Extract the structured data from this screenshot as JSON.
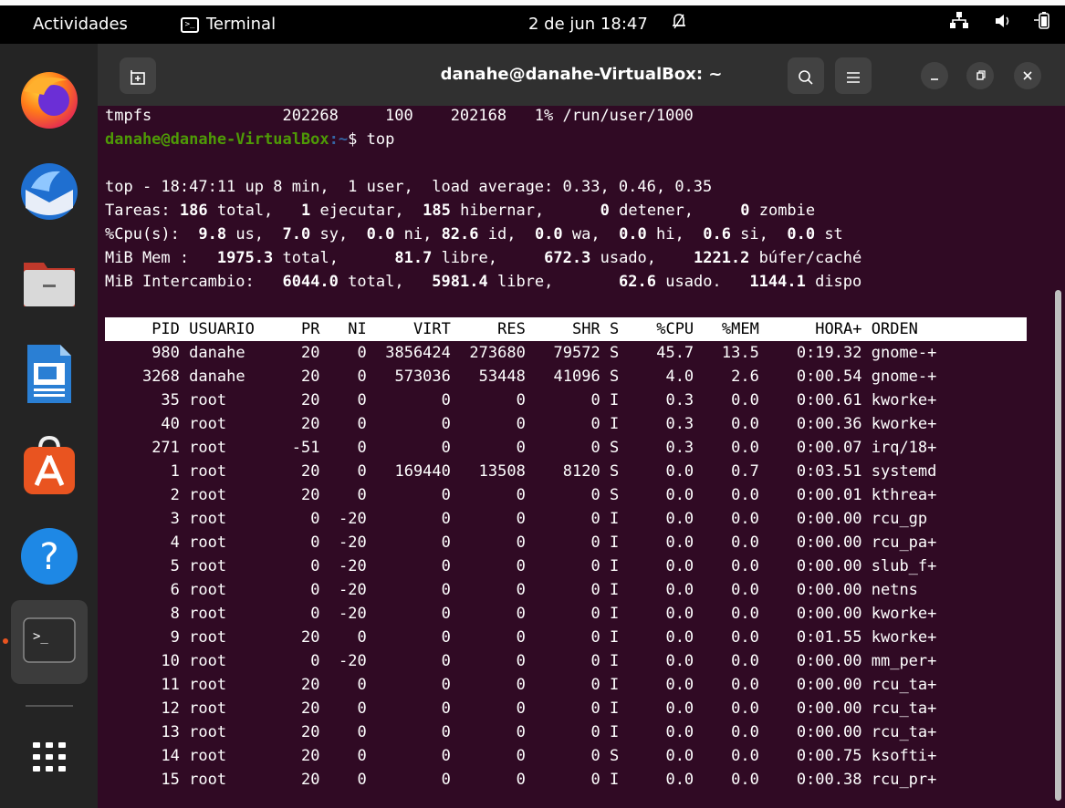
{
  "topbar": {
    "activities": "Actividades",
    "app_name": "Terminal",
    "clock": "2 de jun 18:47"
  },
  "dock": {
    "apps": [
      "firefox",
      "thunderbird",
      "files",
      "libreoffice-writer",
      "software-center",
      "help",
      "terminal",
      "show-apps"
    ]
  },
  "window": {
    "title": "danahe@danahe-VirtualBox: ~"
  },
  "terminal": {
    "df_line": "tmpfs              202268     100    202168   1% /run/user/1000",
    "prompt_user": "danahe@danahe-VirtualBox",
    "prompt_path": ":~",
    "prompt_sym": "$ ",
    "command": "top",
    "summary": {
      "uptime": "top - 18:47:11 up 8 min,  1 user,  load average: 0.33, 0.46, 0.35",
      "tasks": {
        "label": "Tareas:",
        "total": "186",
        "total_l": "total,",
        "run": "1",
        "run_l": "ejecutar,",
        "sleep": "185",
        "sleep_l": "hibernar,",
        "stop": "0",
        "stop_l": "detener,",
        "zombie": "0",
        "zombie_l": "zombie"
      },
      "cpu": {
        "label": "%Cpu(s):",
        "us": "9.8",
        "sy": "7.0",
        "ni": "0.0",
        "id": "82.6",
        "wa": "0.0",
        "hi": "0.0",
        "si": "0.6",
        "st": "0.0"
      },
      "mem": {
        "label": "MiB Mem :",
        "total": "1975.3",
        "total_l": "total,",
        "free": "81.7",
        "free_l": "libre,",
        "used": "672.3",
        "used_l": "usado,",
        "cache": "1221.2",
        "cache_l": "búfer/caché"
      },
      "swap": {
        "label": "MiB Intercambio:",
        "total": "6044.0",
        "total_l": "total,",
        "free": "5981.4",
        "free_l": "libre,",
        "used": "62.6",
        "used_l": "usado.",
        "avail": "1144.1",
        "avail_l": "dispo"
      }
    },
    "columns": [
      "PID",
      "USUARIO",
      "PR",
      "NI",
      "VIRT",
      "RES",
      "SHR",
      "S",
      "%CPU",
      "%MEM",
      "HORA+",
      "ORDEN"
    ],
    "processes": [
      [
        "980",
        "danahe",
        "20",
        "0",
        "3856424",
        "273680",
        "79572",
        "S",
        "45.7",
        "13.5",
        "0:19.32",
        "gnome-+"
      ],
      [
        "3268",
        "danahe",
        "20",
        "0",
        "573036",
        "53448",
        "41096",
        "S",
        "4.0",
        "2.6",
        "0:00.54",
        "gnome-+"
      ],
      [
        "35",
        "root",
        "20",
        "0",
        "0",
        "0",
        "0",
        "I",
        "0.3",
        "0.0",
        "0:00.61",
        "kworke+"
      ],
      [
        "40",
        "root",
        "20",
        "0",
        "0",
        "0",
        "0",
        "I",
        "0.3",
        "0.0",
        "0:00.36",
        "kworke+"
      ],
      [
        "271",
        "root",
        "-51",
        "0",
        "0",
        "0",
        "0",
        "S",
        "0.3",
        "0.0",
        "0:00.07",
        "irq/18+"
      ],
      [
        "1",
        "root",
        "20",
        "0",
        "169440",
        "13508",
        "8120",
        "S",
        "0.0",
        "0.7",
        "0:03.51",
        "systemd"
      ],
      [
        "2",
        "root",
        "20",
        "0",
        "0",
        "0",
        "0",
        "S",
        "0.0",
        "0.0",
        "0:00.01",
        "kthrea+"
      ],
      [
        "3",
        "root",
        "0",
        "-20",
        "0",
        "0",
        "0",
        "I",
        "0.0",
        "0.0",
        "0:00.00",
        "rcu_gp"
      ],
      [
        "4",
        "root",
        "0",
        "-20",
        "0",
        "0",
        "0",
        "I",
        "0.0",
        "0.0",
        "0:00.00",
        "rcu_pa+"
      ],
      [
        "5",
        "root",
        "0",
        "-20",
        "0",
        "0",
        "0",
        "I",
        "0.0",
        "0.0",
        "0:00.00",
        "slub_f+"
      ],
      [
        "6",
        "root",
        "0",
        "-20",
        "0",
        "0",
        "0",
        "I",
        "0.0",
        "0.0",
        "0:00.00",
        "netns"
      ],
      [
        "8",
        "root",
        "0",
        "-20",
        "0",
        "0",
        "0",
        "I",
        "0.0",
        "0.0",
        "0:00.00",
        "kworke+"
      ],
      [
        "9",
        "root",
        "20",
        "0",
        "0",
        "0",
        "0",
        "I",
        "0.0",
        "0.0",
        "0:01.55",
        "kworke+"
      ],
      [
        "10",
        "root",
        "0",
        "-20",
        "0",
        "0",
        "0",
        "I",
        "0.0",
        "0.0",
        "0:00.00",
        "mm_per+"
      ],
      [
        "11",
        "root",
        "20",
        "0",
        "0",
        "0",
        "0",
        "I",
        "0.0",
        "0.0",
        "0:00.00",
        "rcu_ta+"
      ],
      [
        "12",
        "root",
        "20",
        "0",
        "0",
        "0",
        "0",
        "I",
        "0.0",
        "0.0",
        "0:00.00",
        "rcu_ta+"
      ],
      [
        "13",
        "root",
        "20",
        "0",
        "0",
        "0",
        "0",
        "I",
        "0.0",
        "0.0",
        "0:00.00",
        "rcu_ta+"
      ],
      [
        "14",
        "root",
        "20",
        "0",
        "0",
        "0",
        "0",
        "S",
        "0.0",
        "0.0",
        "0:00.75",
        "ksofti+"
      ],
      [
        "15",
        "root",
        "20",
        "0",
        "0",
        "0",
        "0",
        "I",
        "0.0",
        "0.0",
        "0:00.38",
        "rcu_pr+"
      ]
    ]
  },
  "colors": {
    "terminal_bg": "#300a24",
    "prompt_green": "#4e9a06",
    "prompt_blue": "#3465a4",
    "dock_bg": "#242424",
    "headerbar_bg": "#303030"
  }
}
